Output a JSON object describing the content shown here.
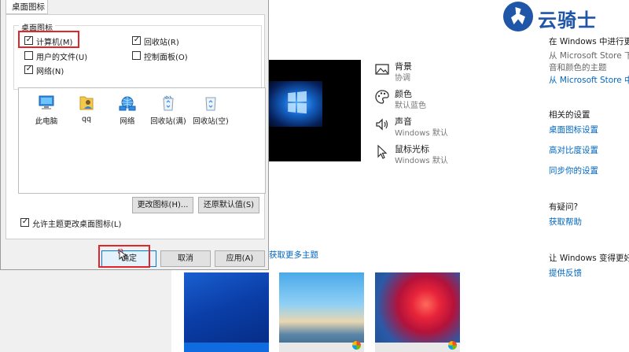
{
  "settings": {
    "items": [
      {
        "title": "背景",
        "subtitle": "协调",
        "icon": "image-icon"
      },
      {
        "title": "颜色",
        "subtitle": "默认蓝色",
        "icon": "palette-icon"
      },
      {
        "title": "声音",
        "subtitle": "Windows 默认",
        "icon": "speaker-icon"
      },
      {
        "title": "鼠标光标",
        "subtitle": "Windows 默认",
        "icon": "cursor-icon"
      }
    ],
    "more_themes_link": "获取更多主题",
    "right_panel": {
      "windows_title": "在 Windows 中进行更多",
      "store_line1": "从 Microsoft Store 下载",
      "store_line2": "音和颜色的主题",
      "store_link": "从 Microsoft Store 中获取",
      "related_title": "相关的设置",
      "related_links": [
        "桌面图标设置",
        "高对比度设置",
        "同步你的设置"
      ],
      "help_title": "有疑问?",
      "help_link": "获取帮助",
      "feedback_title": "让 Windows 变得更好",
      "feedback_link": "提供反馈"
    },
    "themes": [
      "Windows 10",
      "beach",
      "flower"
    ]
  },
  "logo": {
    "text": "云骑士"
  },
  "dialog": {
    "tab_label": "桌面图标",
    "group_label": "桌面图标",
    "checkboxes": [
      {
        "label": "计算机(M)",
        "checked": true
      },
      {
        "label": "回收站(R)",
        "checked": true
      },
      {
        "label": "用户的文件(U)",
        "checked": false
      },
      {
        "label": "控制面板(O)",
        "checked": false
      },
      {
        "label": "网络(N)",
        "checked": true
      }
    ],
    "icons": [
      "此电脑",
      "qq",
      "网络",
      "回收站(满)",
      "回收站(空)"
    ],
    "change_icon_button": "更改图标(H)...",
    "restore_default_button": "还原默认值(S)",
    "allow_themes_checkbox": {
      "label": "允许主题更改桌面图标(L)",
      "checked": true
    },
    "ok_button": "确定",
    "cancel_button": "取消",
    "apply_button": "应用(A)"
  },
  "colors": {
    "accent": "#0067c0",
    "highlight": "#e0252b",
    "brand": "#1f56a8"
  }
}
